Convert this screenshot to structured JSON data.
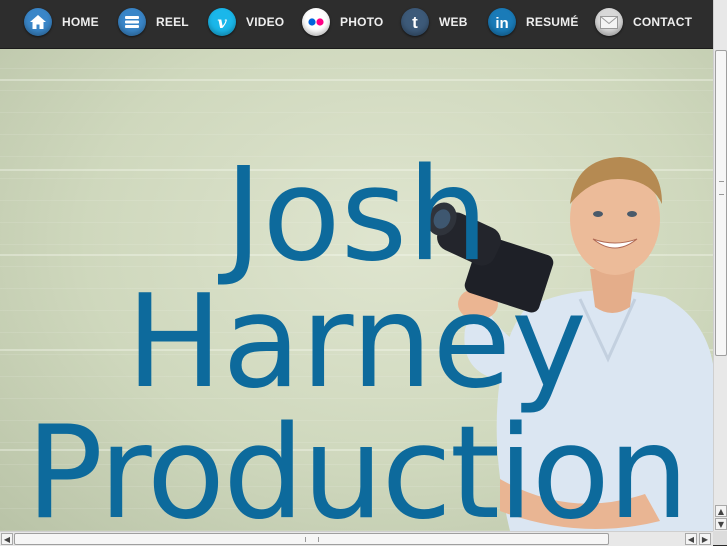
{
  "nav": {
    "items": [
      {
        "label": "HOME",
        "icon": "home-icon",
        "color": "#3a86c8"
      },
      {
        "label": "REEL",
        "icon": "list-icon",
        "color": "#3a86c8"
      },
      {
        "label": "VIDEO",
        "icon": "vimeo-icon",
        "color": "#1ab7ea"
      },
      {
        "label": "PHOTO",
        "icon": "flickr-icon",
        "color": "#ffffff"
      },
      {
        "label": "WEB",
        "icon": "tumblr-icon",
        "color": "#3d5a79"
      },
      {
        "label": "RESUMÉ",
        "icon": "linkedin-icon",
        "color": "#1a7bb8"
      },
      {
        "label": "CONTACT",
        "icon": "mail-icon",
        "color": "#d8d8d8"
      }
    ]
  },
  "hero": {
    "headline_line1": "Josh",
    "headline_line2": "Harney",
    "headline_line3": "Production",
    "headline_color": "#0d6a9c"
  }
}
